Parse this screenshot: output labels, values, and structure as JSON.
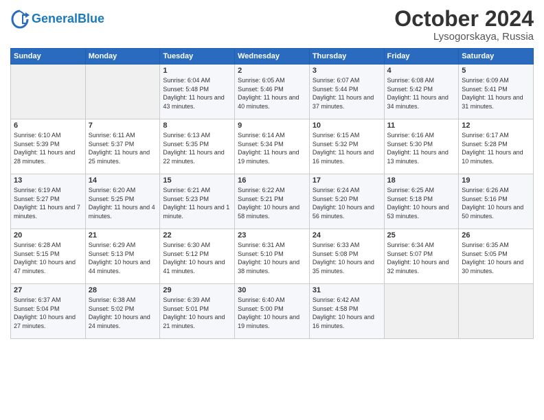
{
  "header": {
    "logo_general": "General",
    "logo_blue": "Blue",
    "month_title": "October 2024",
    "location": "Lysogorskaya, Russia"
  },
  "days_of_week": [
    "Sunday",
    "Monday",
    "Tuesday",
    "Wednesday",
    "Thursday",
    "Friday",
    "Saturday"
  ],
  "weeks": [
    [
      {
        "day": "",
        "sunrise": "",
        "sunset": "",
        "daylight": "",
        "empty": true
      },
      {
        "day": "",
        "sunrise": "",
        "sunset": "",
        "daylight": "",
        "empty": true
      },
      {
        "day": "1",
        "sunrise": "Sunrise: 6:04 AM",
        "sunset": "Sunset: 5:48 PM",
        "daylight": "Daylight: 11 hours and 43 minutes."
      },
      {
        "day": "2",
        "sunrise": "Sunrise: 6:05 AM",
        "sunset": "Sunset: 5:46 PM",
        "daylight": "Daylight: 11 hours and 40 minutes."
      },
      {
        "day": "3",
        "sunrise": "Sunrise: 6:07 AM",
        "sunset": "Sunset: 5:44 PM",
        "daylight": "Daylight: 11 hours and 37 minutes."
      },
      {
        "day": "4",
        "sunrise": "Sunrise: 6:08 AM",
        "sunset": "Sunset: 5:42 PM",
        "daylight": "Daylight: 11 hours and 34 minutes."
      },
      {
        "day": "5",
        "sunrise": "Sunrise: 6:09 AM",
        "sunset": "Sunset: 5:41 PM",
        "daylight": "Daylight: 11 hours and 31 minutes."
      }
    ],
    [
      {
        "day": "6",
        "sunrise": "Sunrise: 6:10 AM",
        "sunset": "Sunset: 5:39 PM",
        "daylight": "Daylight: 11 hours and 28 minutes."
      },
      {
        "day": "7",
        "sunrise": "Sunrise: 6:11 AM",
        "sunset": "Sunset: 5:37 PM",
        "daylight": "Daylight: 11 hours and 25 minutes."
      },
      {
        "day": "8",
        "sunrise": "Sunrise: 6:13 AM",
        "sunset": "Sunset: 5:35 PM",
        "daylight": "Daylight: 11 hours and 22 minutes."
      },
      {
        "day": "9",
        "sunrise": "Sunrise: 6:14 AM",
        "sunset": "Sunset: 5:34 PM",
        "daylight": "Daylight: 11 hours and 19 minutes."
      },
      {
        "day": "10",
        "sunrise": "Sunrise: 6:15 AM",
        "sunset": "Sunset: 5:32 PM",
        "daylight": "Daylight: 11 hours and 16 minutes."
      },
      {
        "day": "11",
        "sunrise": "Sunrise: 6:16 AM",
        "sunset": "Sunset: 5:30 PM",
        "daylight": "Daylight: 11 hours and 13 minutes."
      },
      {
        "day": "12",
        "sunrise": "Sunrise: 6:17 AM",
        "sunset": "Sunset: 5:28 PM",
        "daylight": "Daylight: 11 hours and 10 minutes."
      }
    ],
    [
      {
        "day": "13",
        "sunrise": "Sunrise: 6:19 AM",
        "sunset": "Sunset: 5:27 PM",
        "daylight": "Daylight: 11 hours and 7 minutes."
      },
      {
        "day": "14",
        "sunrise": "Sunrise: 6:20 AM",
        "sunset": "Sunset: 5:25 PM",
        "daylight": "Daylight: 11 hours and 4 minutes."
      },
      {
        "day": "15",
        "sunrise": "Sunrise: 6:21 AM",
        "sunset": "Sunset: 5:23 PM",
        "daylight": "Daylight: 11 hours and 1 minute."
      },
      {
        "day": "16",
        "sunrise": "Sunrise: 6:22 AM",
        "sunset": "Sunset: 5:21 PM",
        "daylight": "Daylight: 10 hours and 58 minutes."
      },
      {
        "day": "17",
        "sunrise": "Sunrise: 6:24 AM",
        "sunset": "Sunset: 5:20 PM",
        "daylight": "Daylight: 10 hours and 56 minutes."
      },
      {
        "day": "18",
        "sunrise": "Sunrise: 6:25 AM",
        "sunset": "Sunset: 5:18 PM",
        "daylight": "Daylight: 10 hours and 53 minutes."
      },
      {
        "day": "19",
        "sunrise": "Sunrise: 6:26 AM",
        "sunset": "Sunset: 5:16 PM",
        "daylight": "Daylight: 10 hours and 50 minutes."
      }
    ],
    [
      {
        "day": "20",
        "sunrise": "Sunrise: 6:28 AM",
        "sunset": "Sunset: 5:15 PM",
        "daylight": "Daylight: 10 hours and 47 minutes."
      },
      {
        "day": "21",
        "sunrise": "Sunrise: 6:29 AM",
        "sunset": "Sunset: 5:13 PM",
        "daylight": "Daylight: 10 hours and 44 minutes."
      },
      {
        "day": "22",
        "sunrise": "Sunrise: 6:30 AM",
        "sunset": "Sunset: 5:12 PM",
        "daylight": "Daylight: 10 hours and 41 minutes."
      },
      {
        "day": "23",
        "sunrise": "Sunrise: 6:31 AM",
        "sunset": "Sunset: 5:10 PM",
        "daylight": "Daylight: 10 hours and 38 minutes."
      },
      {
        "day": "24",
        "sunrise": "Sunrise: 6:33 AM",
        "sunset": "Sunset: 5:08 PM",
        "daylight": "Daylight: 10 hours and 35 minutes."
      },
      {
        "day": "25",
        "sunrise": "Sunrise: 6:34 AM",
        "sunset": "Sunset: 5:07 PM",
        "daylight": "Daylight: 10 hours and 32 minutes."
      },
      {
        "day": "26",
        "sunrise": "Sunrise: 6:35 AM",
        "sunset": "Sunset: 5:05 PM",
        "daylight": "Daylight: 10 hours and 30 minutes."
      }
    ],
    [
      {
        "day": "27",
        "sunrise": "Sunrise: 6:37 AM",
        "sunset": "Sunset: 5:04 PM",
        "daylight": "Daylight: 10 hours and 27 minutes."
      },
      {
        "day": "28",
        "sunrise": "Sunrise: 6:38 AM",
        "sunset": "Sunset: 5:02 PM",
        "daylight": "Daylight: 10 hours and 24 minutes."
      },
      {
        "day": "29",
        "sunrise": "Sunrise: 6:39 AM",
        "sunset": "Sunset: 5:01 PM",
        "daylight": "Daylight: 10 hours and 21 minutes."
      },
      {
        "day": "30",
        "sunrise": "Sunrise: 6:40 AM",
        "sunset": "Sunset: 5:00 PM",
        "daylight": "Daylight: 10 hours and 19 minutes."
      },
      {
        "day": "31",
        "sunrise": "Sunrise: 6:42 AM",
        "sunset": "Sunset: 4:58 PM",
        "daylight": "Daylight: 10 hours and 16 minutes."
      },
      {
        "day": "",
        "sunrise": "",
        "sunset": "",
        "daylight": "",
        "empty": true
      },
      {
        "day": "",
        "sunrise": "",
        "sunset": "",
        "daylight": "",
        "empty": true
      }
    ]
  ]
}
